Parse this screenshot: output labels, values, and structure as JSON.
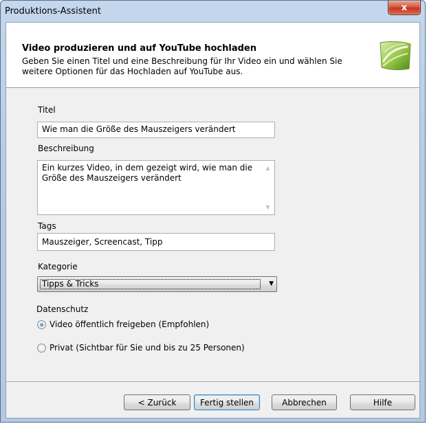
{
  "window": {
    "title": "Produktions-Assistent",
    "close_glyph": "x"
  },
  "header": {
    "title": "Video produzieren und auf YouTube hochladen",
    "description": "Geben Sie einen Titel und eine Beschreibung für Ihr Video ein und wählen Sie weitere Optionen für das Hochladen auf YouTube aus.",
    "icon": "wizard-page-icon"
  },
  "form": {
    "title_label": "Titel",
    "title_value": "Wie man die Größe des Mauszeigers verändert",
    "description_label": "Beschreibung",
    "description_value": "Ein kurzes Video, in dem gezeigt wird, wie man die Größe des Mauszeigers verändert",
    "tags_label": "Tags",
    "tags_value": "Mauszeiger, Screencast, Tipp",
    "category_label": "Kategorie",
    "category_value": "Tipps & Tricks",
    "privacy_label": "Datenschutz",
    "privacy_options": [
      {
        "label": "Video öffentlich freigeben (Empfohlen)",
        "selected": true
      },
      {
        "label": "Privat (Sichtbar für Sie und bis zu 25 Personen)",
        "selected": false
      }
    ]
  },
  "buttons": {
    "back": "< Zurück",
    "finish": "Fertig stellen",
    "cancel": "Abbrechen",
    "help": "Hilfe"
  },
  "colors": {
    "accent_frame": "#b6cbe5",
    "close_button": "#c5361c",
    "dialog_bg": "#f0f0f0"
  }
}
